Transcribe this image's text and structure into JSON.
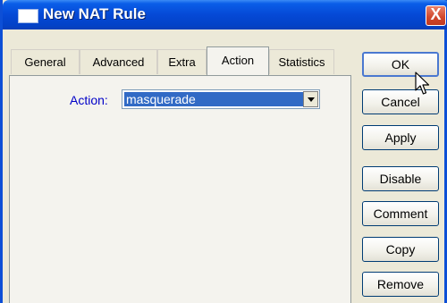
{
  "window": {
    "title": "New NAT Rule",
    "close_label": "X"
  },
  "tabs": [
    "General",
    "Advanced",
    "Extra",
    "Action",
    "Statistics"
  ],
  "active_tab": "Action",
  "form": {
    "action_label": "Action:",
    "action_value": "masquerade"
  },
  "buttons": {
    "ok": "OK",
    "cancel": "Cancel",
    "apply": "Apply",
    "disable": "Disable",
    "comment": "Comment",
    "copy": "Copy",
    "remove": "Remove"
  }
}
